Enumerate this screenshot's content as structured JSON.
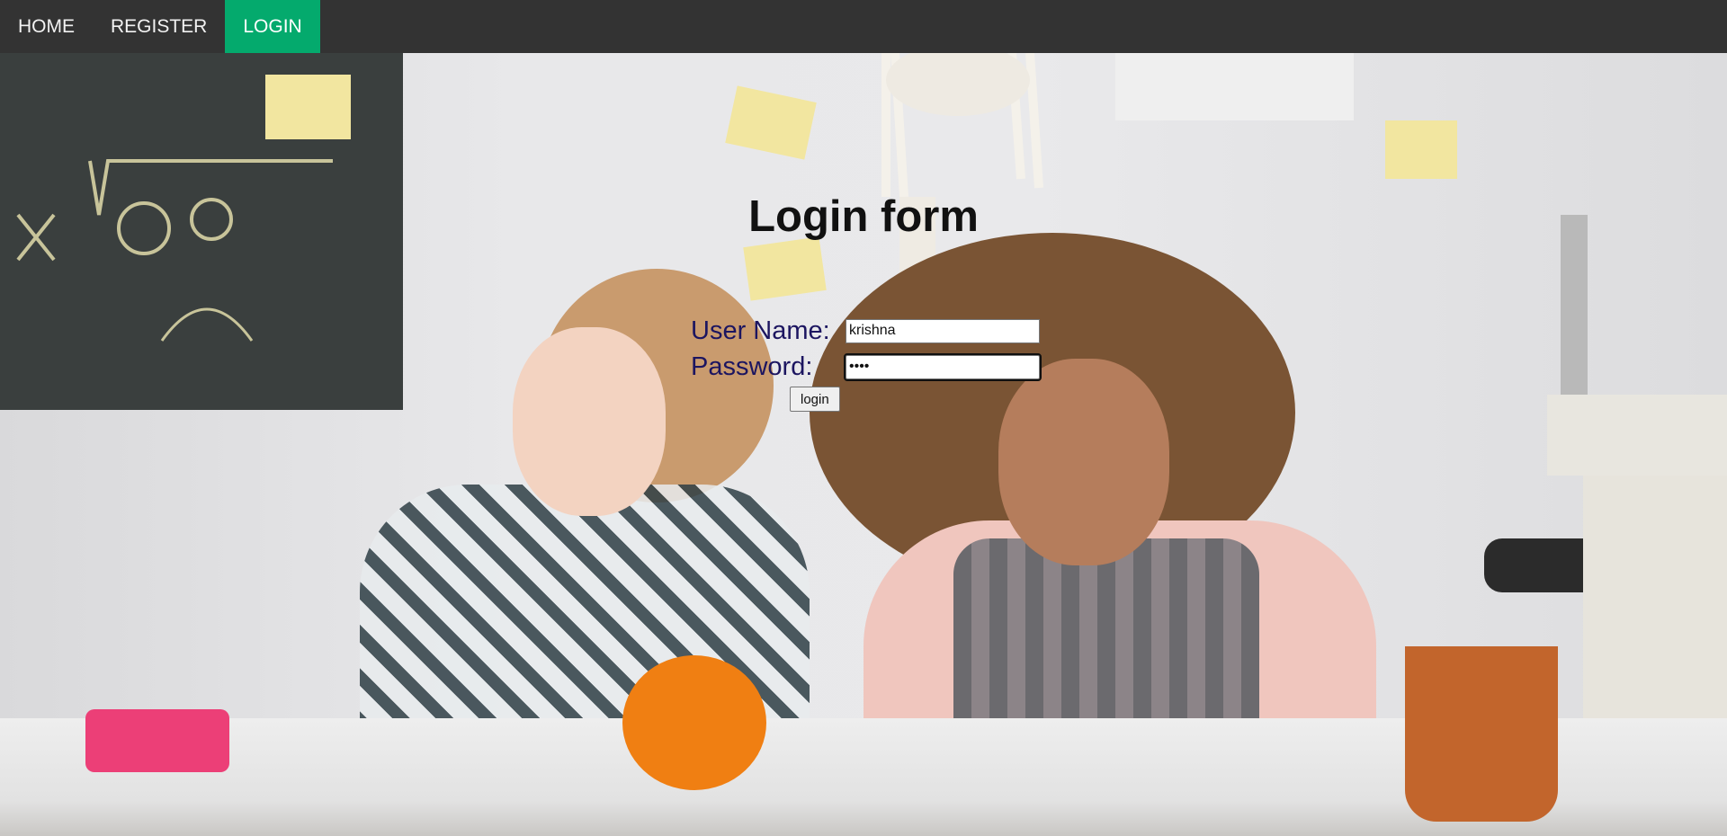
{
  "nav": {
    "items": [
      {
        "label": "HOME",
        "active": false
      },
      {
        "label": "REGISTER",
        "active": false
      },
      {
        "label": "LOGIN",
        "active": true
      }
    ],
    "active_color": "#04AA6D",
    "bar_color": "#333333"
  },
  "form": {
    "title": "Login form",
    "username_label": "User Name:",
    "username_value": "krishna",
    "password_label": "Password:",
    "password_value": "••••",
    "submit_label": "login"
  },
  "background": {
    "description_icon": "classroom-science-photo"
  }
}
